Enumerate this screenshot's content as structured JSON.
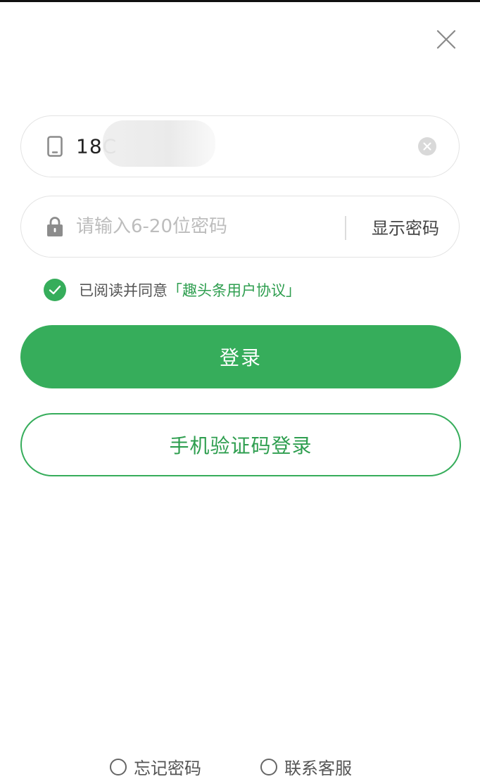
{
  "header": {
    "close_icon": "close-icon"
  },
  "phone_field": {
    "icon": "phone-icon",
    "value": "18C",
    "clear_icon": "clear-icon"
  },
  "password_field": {
    "icon": "lock-icon",
    "placeholder": "请输入6-20位密码",
    "value": "",
    "show_password_label": "显示密码"
  },
  "agreement": {
    "checked": true,
    "check_icon": "checkmark-icon",
    "prefix": "已阅读并同意",
    "link_text": "「趣头条用户协议」"
  },
  "buttons": {
    "login_label": "登录",
    "sms_login_label": "手机验证码登录"
  },
  "footer": {
    "forgot_password_label": "忘记密码",
    "contact_support_label": "联系客服"
  },
  "colors": {
    "accent": "#36ad5b",
    "link": "#2e9e4f",
    "placeholder": "#bdbdbd",
    "border": "#e3e3e3"
  }
}
